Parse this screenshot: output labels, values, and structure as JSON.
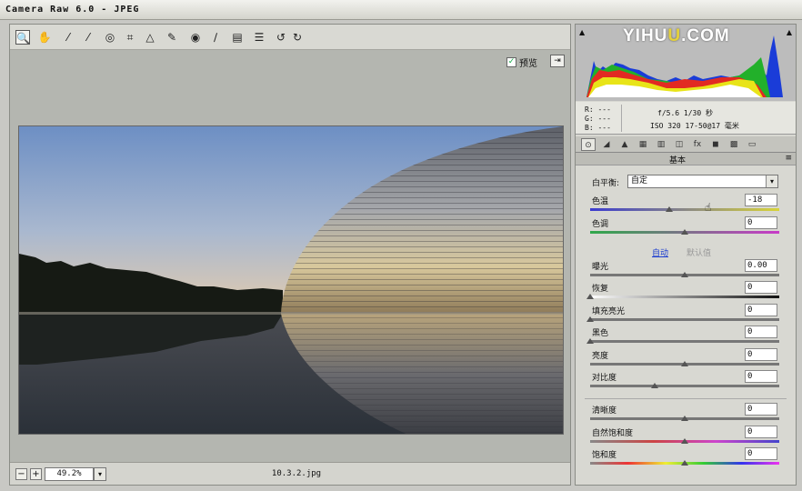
{
  "window": {
    "title": "Camera Raw 6.0 -  JPEG"
  },
  "toolbar": {
    "tools": [
      {
        "name": "zoom-tool-icon",
        "glyph": "🔍",
        "active": true
      },
      {
        "name": "hand-tool-icon",
        "glyph": "✋"
      },
      {
        "name": "white-balance-tool-icon",
        "glyph": "⁄"
      },
      {
        "name": "color-sampler-tool-icon",
        "glyph": "⁄"
      },
      {
        "name": "targeted-adjustment-tool-icon",
        "glyph": "◎"
      },
      {
        "name": "crop-tool-icon",
        "glyph": "⌗"
      },
      {
        "name": "straighten-tool-icon",
        "glyph": "△"
      },
      {
        "name": "spot-removal-tool-icon",
        "glyph": "✎"
      },
      {
        "name": "red-eye-tool-icon",
        "glyph": "◉"
      },
      {
        "name": "adjustment-brush-icon",
        "glyph": "∕"
      },
      {
        "name": "graduated-filter-icon",
        "glyph": "▤"
      },
      {
        "name": "preferences-icon",
        "glyph": "☰"
      },
      {
        "name": "rotate-ccw-icon",
        "glyph": "↺"
      },
      {
        "name": "rotate-cw-icon",
        "glyph": "↻"
      }
    ],
    "preview_label": "预览",
    "preview_checked": "✓",
    "fullscreen_glyph": "⇥"
  },
  "status": {
    "zoom": "49.2%",
    "filename": "10.3.2.jpg",
    "minus": "−",
    "plus": "+",
    "dd": "▾"
  },
  "histogram": {
    "watermark_a": "YIHU",
    "watermark_b": "U",
    "watermark_c": ".COM",
    "clip_left": "▲",
    "clip_right": "▲"
  },
  "camera_info": {
    "r": "R: ---",
    "g": "G: ---",
    "b": "B: ---",
    "line1": "f/5.6  1/30 秒",
    "line2": "ISO 320  17-50@17 毫米"
  },
  "tabs": [
    "⊙",
    "◢",
    "▲",
    "▦",
    "▥",
    "◫",
    "fx",
    "◼",
    "▩",
    "▭"
  ],
  "panel": {
    "title": "基本",
    "menu": "≡",
    "white_balance_label": "白平衡:",
    "white_balance_value": "自定",
    "white_balance_arrow": "▾",
    "auto_link": "自动",
    "default_link": "默认值",
    "sliders": [
      {
        "label": "色温",
        "value": "-18",
        "pos": 0.42,
        "track": "temp"
      },
      {
        "label": "色调",
        "value": "0",
        "pos": 0.5,
        "track": "tint"
      },
      {
        "label": "曝光",
        "value": "0.00",
        "pos": 0.5,
        "track": "gray"
      },
      {
        "label": "恢复",
        "value": "0",
        "pos": 0.0,
        "track": "dark"
      },
      {
        "label": "填充亮光",
        "value": "0",
        "pos": 0.0,
        "track": "gray"
      },
      {
        "label": "黑色",
        "value": "0",
        "pos": 0.0,
        "track": "gray"
      },
      {
        "label": "亮度",
        "value": "0",
        "pos": 0.5,
        "track": "gray"
      },
      {
        "label": "对比度",
        "value": "0",
        "pos": 0.34,
        "track": "gray"
      },
      {
        "label": "清晰度",
        "value": "0",
        "pos": 0.5,
        "track": "gray"
      },
      {
        "label": "自然饱和度",
        "value": "0",
        "pos": 0.5,
        "track": "vib"
      },
      {
        "label": "饱和度",
        "value": "0",
        "pos": 0.5,
        "track": "sat"
      }
    ]
  },
  "colors": {
    "link": "#1a3bd0",
    "panel": "#d8d8d2"
  }
}
